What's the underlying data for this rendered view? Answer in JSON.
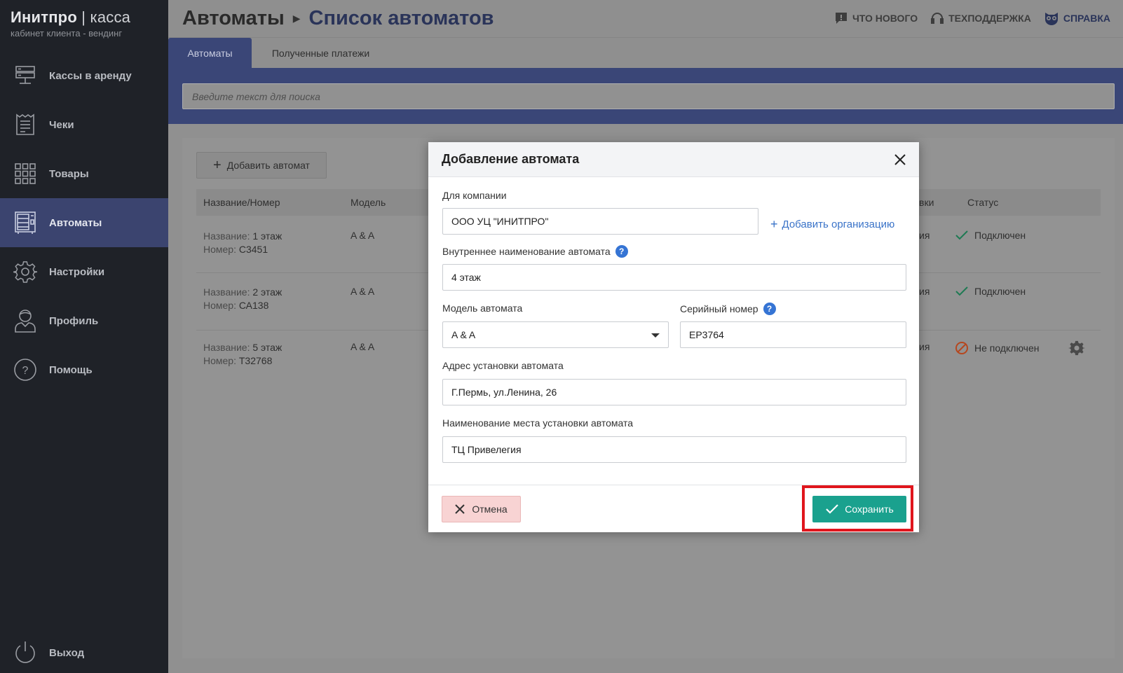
{
  "brand": {
    "name_bold": "Инитпро",
    "name_sep": " | ",
    "name_light": "касса",
    "subtitle": "кабинет клиента - вендинг"
  },
  "sidebar": {
    "items": [
      {
        "label": "Кассы в аренду",
        "icon": "server-icon"
      },
      {
        "label": "Чеки",
        "icon": "receipt-icon"
      },
      {
        "label": "Товары",
        "icon": "grid-icon"
      },
      {
        "label": "Автоматы",
        "icon": "vending-machine-icon",
        "active": true
      },
      {
        "label": "Настройки",
        "icon": "gear-icon"
      },
      {
        "label": "Профиль",
        "icon": "user-icon"
      },
      {
        "label": "Помощь",
        "icon": "question-icon"
      }
    ],
    "logout": "Выход"
  },
  "header": {
    "breadcrumb_root": "Автоматы",
    "breadcrumb_current": "Список автоматов",
    "links": {
      "news": "ЧТО НОВОГО",
      "support": "ТЕХПОДДЕРЖКА",
      "help": "СПРАВКА"
    }
  },
  "tabs": {
    "machines": "Автоматы",
    "payments": "Полученные платежи"
  },
  "search": {
    "placeholder": "Введите текст для поиска"
  },
  "list": {
    "add_button": "Добавить автомат",
    "columns": {
      "name": "Название/Номер",
      "model": "Модель",
      "partial": "вки",
      "status": "Статус"
    },
    "name_key": "Название: ",
    "number_key": "Номер: ",
    "rows": [
      {
        "name": "1 этаж",
        "number": "С3451",
        "model": "A & A",
        "partial": "ия",
        "status": "Подключен",
        "status_ok": true
      },
      {
        "name": "2 этаж",
        "number": "СА138",
        "model": "A & A",
        "partial": "ия",
        "status": "Подключен",
        "status_ok": true
      },
      {
        "name": "5 этаж",
        "number": "Т32768",
        "model": "A & A",
        "partial": "ия",
        "status": "Не подключен",
        "status_ok": false
      }
    ]
  },
  "modal": {
    "title": "Добавление автомата",
    "company_label": "Для компании",
    "company_value": "ООО УЦ \"ИНИТПРО\"",
    "add_org": "Добавить организацию",
    "internal_name_label": "Внутреннее наименование автомата",
    "internal_name_value": "4 этаж",
    "model_label": "Модель автомата",
    "model_value": "A & A",
    "serial_label": "Серийный номер",
    "serial_value": "ЕР3764",
    "address_label": "Адрес установки автомата",
    "address_value": "Г.Пермь, ул.Ленина, 26",
    "place_label": "Наименование места установки автомата",
    "place_value": "ТЦ Привелегия",
    "cancel": "Отмена",
    "save": "Сохранить",
    "help_glyph": "?"
  },
  "colors": {
    "accent": "#3a4677",
    "save": "#1aa18e",
    "cancel_bg": "#f8d3d3",
    "highlight": "#e0161d",
    "link": "#3a73c8"
  }
}
